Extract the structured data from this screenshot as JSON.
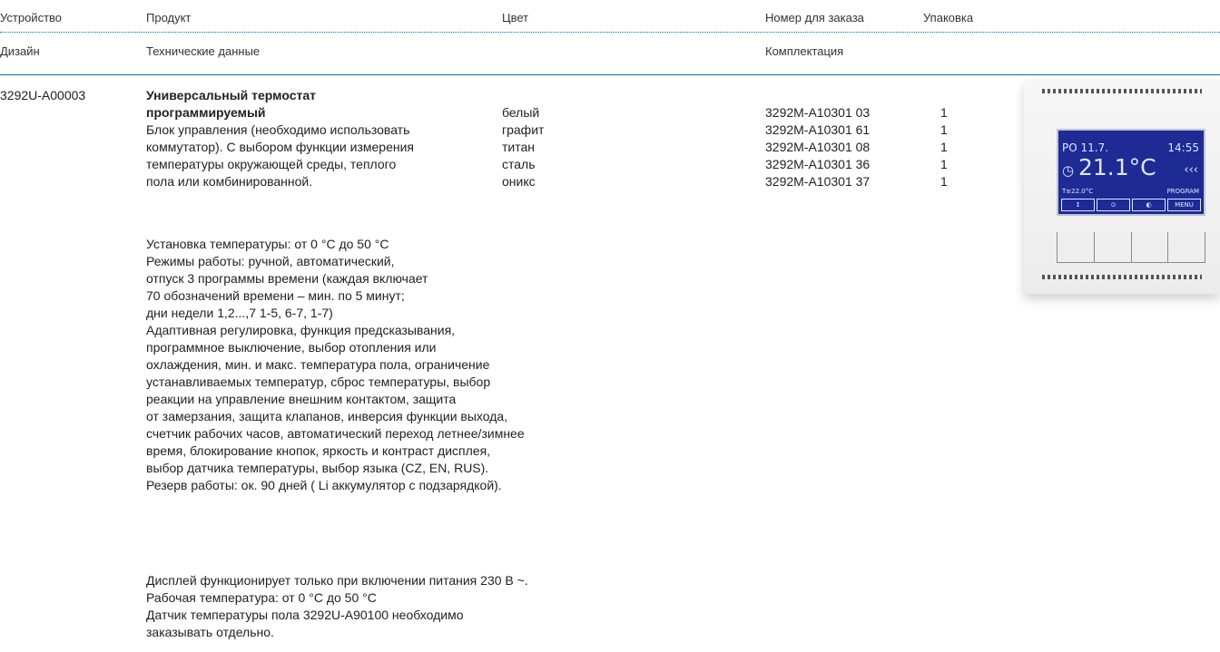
{
  "header": {
    "row1": {
      "device": "Устройство",
      "product": "Продукт",
      "color": "Цвет",
      "order_number": "Номер для заказа",
      "packaging": "Упаковка"
    },
    "row2": {
      "design": "Дизайн",
      "tech_data": "Технические данные",
      "kit": "Комплектация"
    }
  },
  "product": {
    "device_code": "3292U-A00003",
    "title_lines": [
      "Универсальный термостат",
      "программируемый"
    ],
    "description_lines": [
      "Блок управления (необходимо использовать",
      "коммутатор). С выбором функции измерения",
      "температуры окружающей среды, теплого",
      "пола или комбинированной."
    ],
    "variants": [
      {
        "color": "белый",
        "order": "3292M-A10301 03",
        "qty": "1"
      },
      {
        "color": "графит",
        "order": "3292M-A10301 61",
        "qty": "1"
      },
      {
        "color": "титан",
        "order": "3292M-A10301 08",
        "qty": "1"
      },
      {
        "color": "сталь",
        "order": "3292M-A10301 36",
        "qty": "1"
      },
      {
        "color": "оникс",
        "order": "3292M-A10301 37",
        "qty": "1"
      }
    ],
    "specs_lines": [
      "Установка температуры: от 0 °C до 50 °C",
      "Режимы работы: ручной, автоматический,",
      "отпуск 3 программы времени (каждая включает",
      "70 обозначений времени – мин. по 5 минут;",
      "дни недели 1,2...,7 1-5, 6-7, 1-7)",
      "Адаптивная регулировка, функция предсказывания,",
      "программное выключение, выбор отопления или",
      "охлаждения, мин. и макс. температура пола, ограничение",
      "устанавливаемых температур, сброс температуры, выбор",
      "реакции на управление внешним контактом, защита",
      "от замерзания, защита клапанов, инверсия функции выхода,",
      "счетчик рабочих часов, автоматический переход летнее/зимнее",
      "время, блокирование кнопок, яркость и контраст дисплея,",
      "выбор датчика температуры, выбор языка (CZ, EN, RUS).",
      "Резерв работы: ок. 90 дней ( Li аккумулятор с подзарядкой)."
    ],
    "notes_lines": [
      "Дисплей функционирует только при включении питания 230 В ~.",
      "Рабочая температура: от 0 °C до 50 °C",
      "Датчик температуры пола 3292U-A90100 необходимо",
      "заказывать отдельно."
    ]
  },
  "device_image": {
    "screen_date": "PO 11.7.",
    "screen_time": "14:55",
    "screen_temp": "21.1°C",
    "screen_set": "T≡22.0°C",
    "screen_program": "PROGRAM",
    "screen_menu": "MENU",
    "screen_color": "#1e2b95"
  },
  "colors": {
    "accent_rule": "#0072bc"
  }
}
